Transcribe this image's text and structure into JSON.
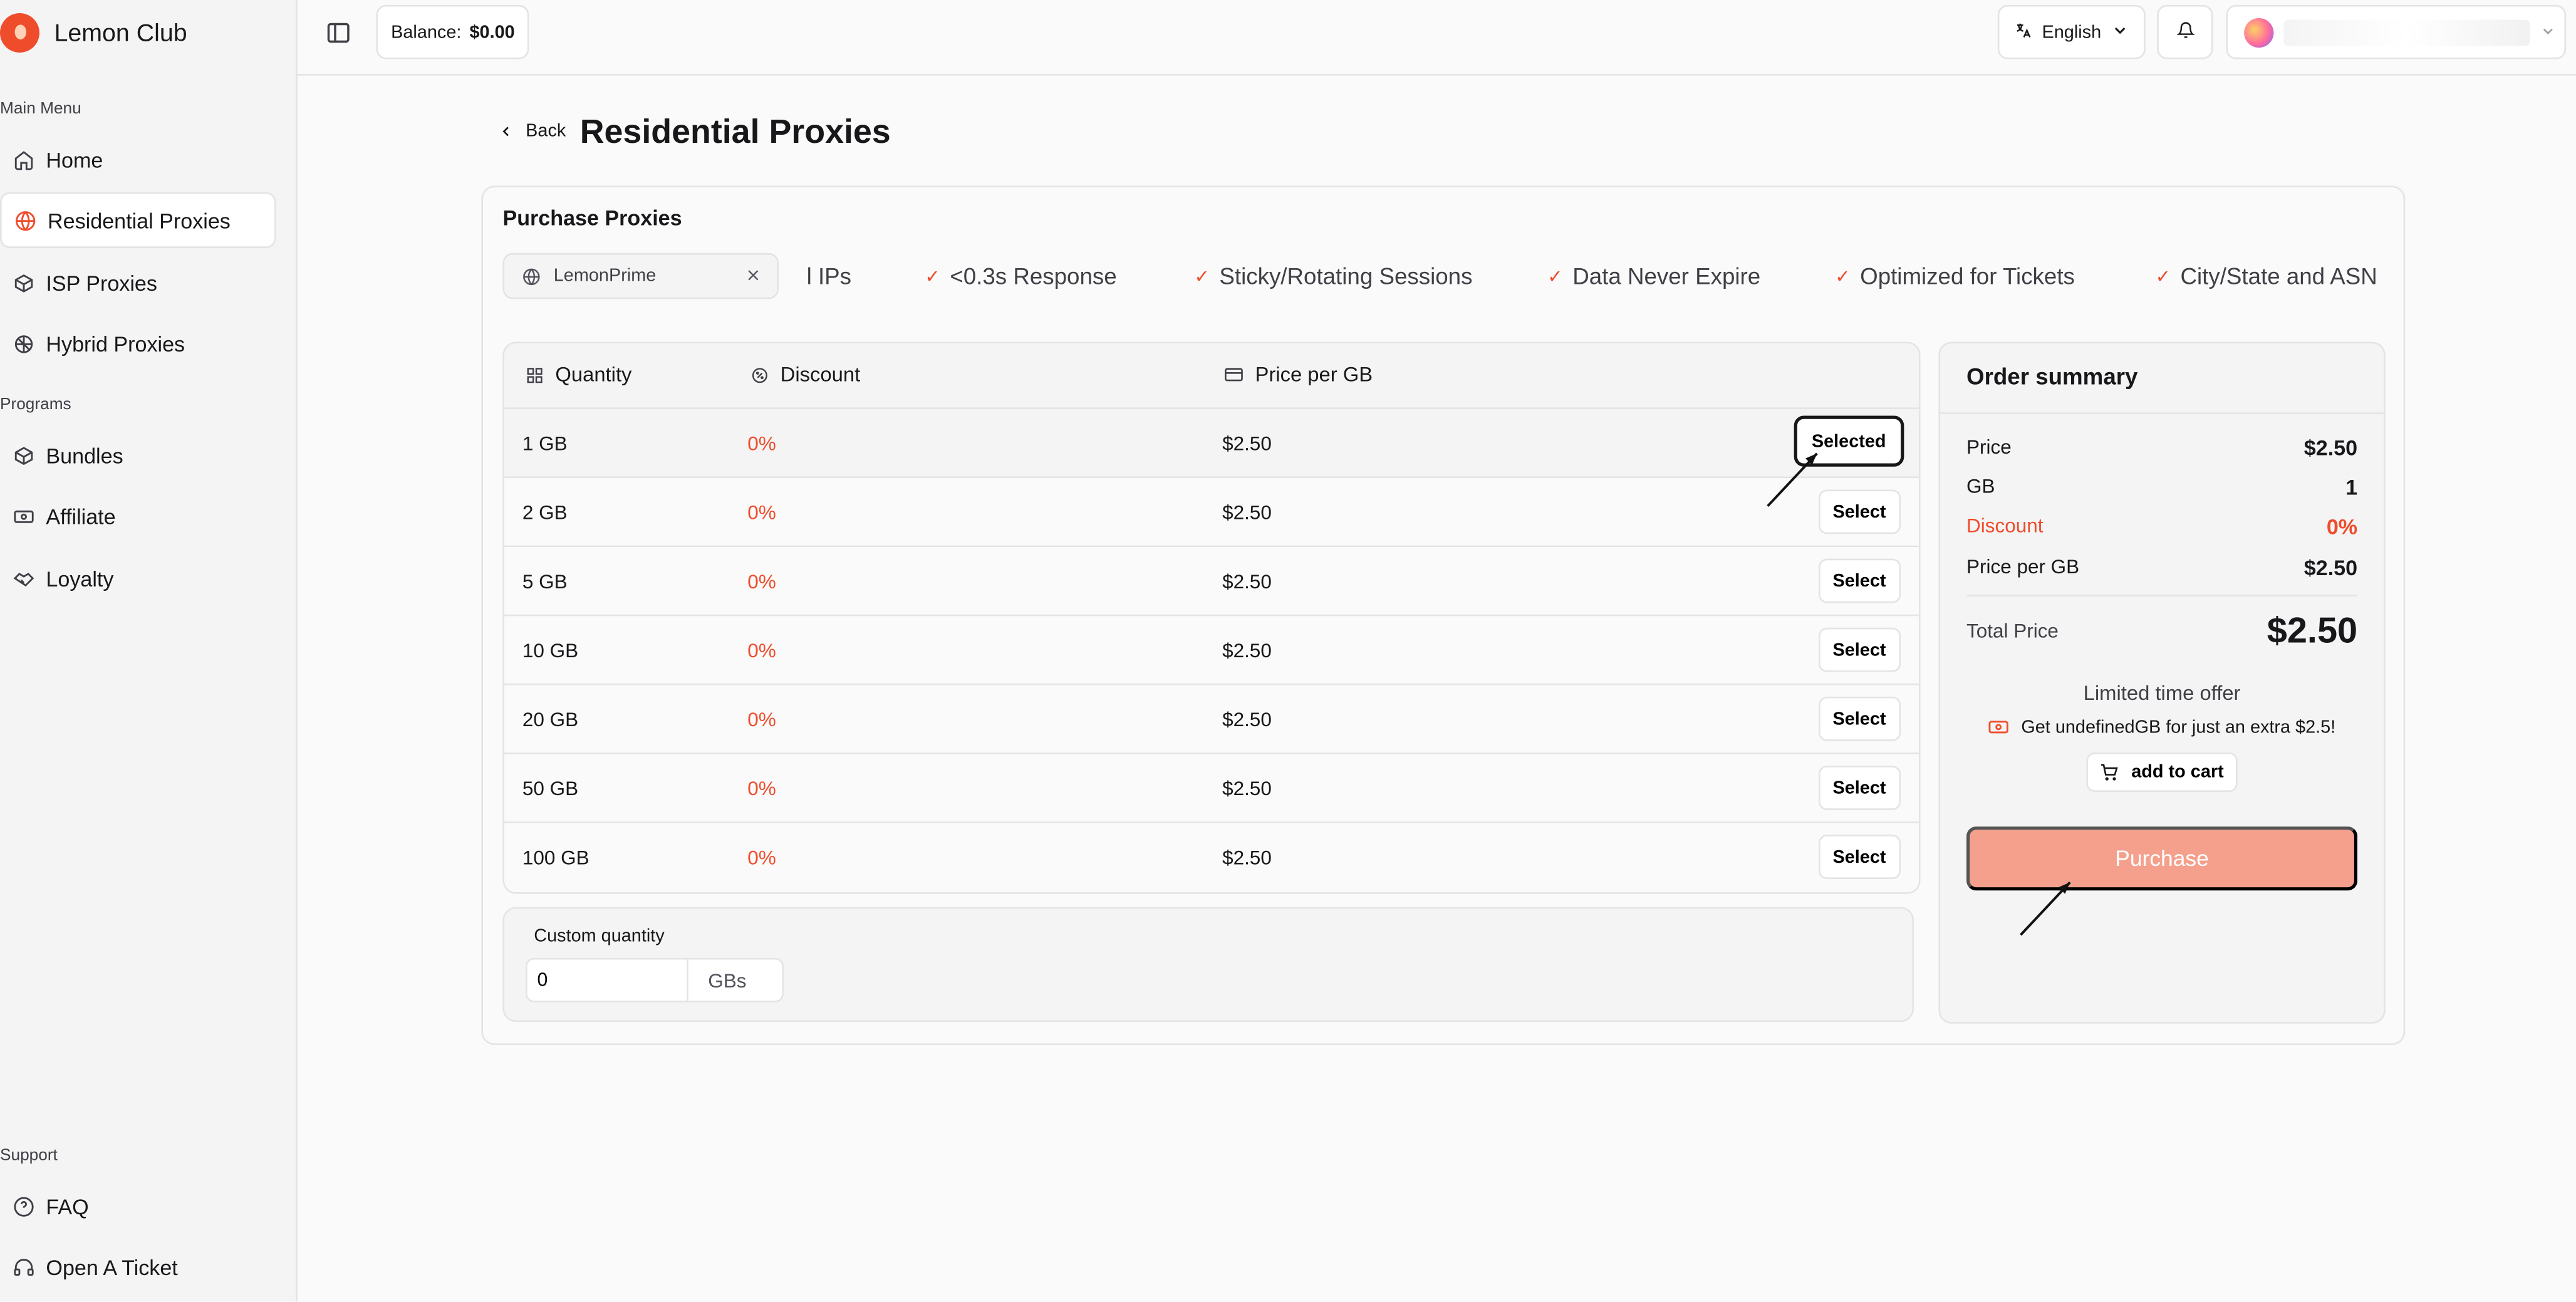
{
  "app": {
    "name": "Lemon Club"
  },
  "sidebar": {
    "main_menu_label": "Main Menu",
    "programs_label": "Programs",
    "support_label": "Support",
    "main_items": [
      {
        "label": "Home",
        "icon": "home-icon"
      },
      {
        "label": "Residential Proxies",
        "icon": "globe-icon",
        "active": true
      },
      {
        "label": "ISP Proxies",
        "icon": "box-icon"
      },
      {
        "label": "Hybrid Proxies",
        "icon": "hybrid-icon"
      }
    ],
    "program_items": [
      {
        "label": "Bundles",
        "icon": "box-icon"
      },
      {
        "label": "Affiliate",
        "icon": "banknote-icon"
      },
      {
        "label": "Loyalty",
        "icon": "handshake-icon"
      }
    ],
    "support_items": [
      {
        "label": "FAQ",
        "icon": "help-circle-icon"
      },
      {
        "label": "Open A Ticket",
        "icon": "headset-icon"
      }
    ]
  },
  "topbar": {
    "balance_label": "Balance:",
    "balance_value": "$0.00",
    "language": "English"
  },
  "page": {
    "back_label": "Back",
    "title": "Residential Proxies",
    "card_title": "Purchase Proxies",
    "product": "LemonPrime",
    "features": [
      "l IPs",
      "<0.3s Response",
      "Sticky/Rotating Sessions",
      "Data Never Expire",
      "Optimized for Tickets",
      "City/State and ASN T"
    ]
  },
  "table": {
    "headers": {
      "quantity": "Quantity",
      "discount": "Discount",
      "price": "Price per GB"
    },
    "rows": [
      {
        "quantity": "1 GB",
        "discount": "0%",
        "price": "$2.50",
        "action": "Selected",
        "selected": true
      },
      {
        "quantity": "2 GB",
        "discount": "0%",
        "price": "$2.50",
        "action": "Select"
      },
      {
        "quantity": "5 GB",
        "discount": "0%",
        "price": "$2.50",
        "action": "Select"
      },
      {
        "quantity": "10 GB",
        "discount": "0%",
        "price": "$2.50",
        "action": "Select"
      },
      {
        "quantity": "20 GB",
        "discount": "0%",
        "price": "$2.50",
        "action": "Select"
      },
      {
        "quantity": "50 GB",
        "discount": "0%",
        "price": "$2.50",
        "action": "Select"
      },
      {
        "quantity": "100 GB",
        "discount": "0%",
        "price": "$2.50",
        "action": "Select"
      }
    ]
  },
  "custom": {
    "label": "Custom quantity",
    "value": "0",
    "unit": "GBs"
  },
  "summary": {
    "title": "Order summary",
    "price_label": "Price",
    "price_value": "$2.50",
    "gb_label": "GB",
    "gb_value": "1",
    "discount_label": "Discount",
    "discount_value": "0%",
    "ppg_label": "Price per GB",
    "ppg_value": "$2.50",
    "total_label": "Total Price",
    "total_value": "$2.50",
    "offer_title": "Limited time offer",
    "offer_text": "Get undefinedGB for just an extra $2.5!",
    "add_to_cart": "add to cart",
    "purchase": "Purchase"
  },
  "colors": {
    "accent": "#ef4c2b",
    "purchase_bg": "#f4a08d"
  }
}
